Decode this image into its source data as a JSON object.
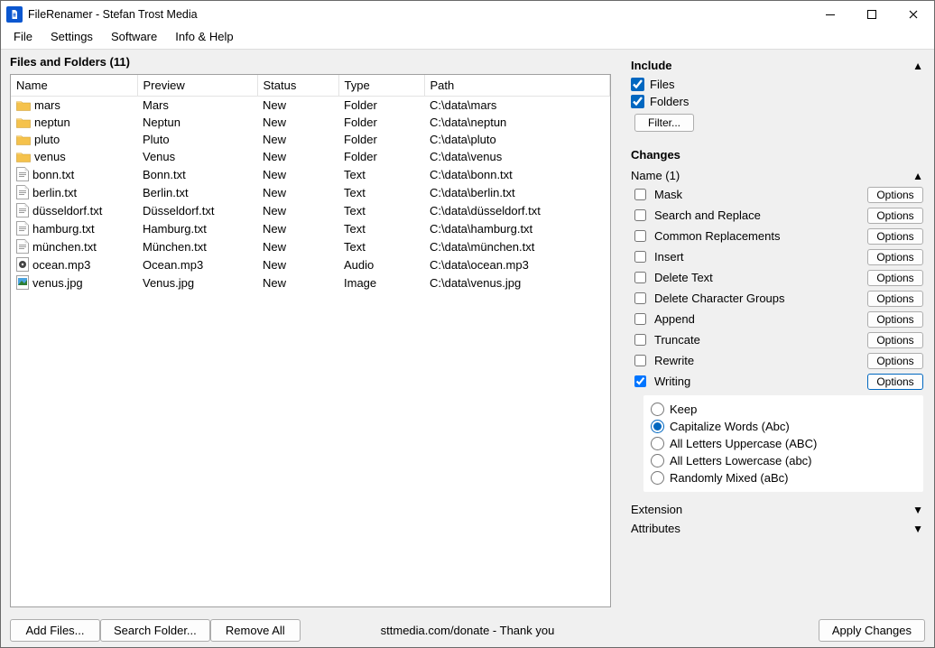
{
  "window": {
    "title": "FileRenamer - Stefan Trost Media"
  },
  "menu": [
    "File",
    "Settings",
    "Software",
    "Info & Help"
  ],
  "files_header_label": "Files and Folders",
  "files_count": 11,
  "columns": [
    "Name",
    "Preview",
    "Status",
    "Type",
    "Path"
  ],
  "rows": [
    {
      "icon": "folder",
      "name": "mars",
      "preview": "Mars",
      "status": "New",
      "type": "Folder",
      "path": "C:\\data\\mars"
    },
    {
      "icon": "folder",
      "name": "neptun",
      "preview": "Neptun",
      "status": "New",
      "type": "Folder",
      "path": "C:\\data\\neptun"
    },
    {
      "icon": "folder",
      "name": "pluto",
      "preview": "Pluto",
      "status": "New",
      "type": "Folder",
      "path": "C:\\data\\pluto"
    },
    {
      "icon": "folder",
      "name": "venus",
      "preview": "Venus",
      "status": "New",
      "type": "Folder",
      "path": "C:\\data\\venus"
    },
    {
      "icon": "text",
      "name": "bonn.txt",
      "preview": "Bonn.txt",
      "status": "New",
      "type": "Text",
      "path": "C:\\data\\bonn.txt"
    },
    {
      "icon": "text",
      "name": "berlin.txt",
      "preview": "Berlin.txt",
      "status": "New",
      "type": "Text",
      "path": "C:\\data\\berlin.txt"
    },
    {
      "icon": "text",
      "name": "düsseldorf.txt",
      "preview": "Düsseldorf.txt",
      "status": "New",
      "type": "Text",
      "path": "C:\\data\\düsseldorf.txt"
    },
    {
      "icon": "text",
      "name": "hamburg.txt",
      "preview": "Hamburg.txt",
      "status": "New",
      "type": "Text",
      "path": "C:\\data\\hamburg.txt"
    },
    {
      "icon": "text",
      "name": "münchen.txt",
      "preview": "München.txt",
      "status": "New",
      "type": "Text",
      "path": "C:\\data\\münchen.txt"
    },
    {
      "icon": "audio",
      "name": "ocean.mp3",
      "preview": "Ocean.mp3",
      "status": "New",
      "type": "Audio",
      "path": "C:\\data\\ocean.mp3"
    },
    {
      "icon": "image",
      "name": "venus.jpg",
      "preview": "Venus.jpg",
      "status": "New",
      "type": "Image",
      "path": "C:\\data\\venus.jpg"
    }
  ],
  "include": {
    "title": "Include",
    "files_label": "Files",
    "files_checked": true,
    "folders_label": "Folders",
    "folders_checked": true,
    "filter_label": "Filter..."
  },
  "changes": {
    "title": "Changes",
    "name_header": "Name (1)",
    "items": [
      {
        "label": "Mask",
        "checked": false,
        "options": "Options"
      },
      {
        "label": "Search and Replace",
        "checked": false,
        "options": "Options"
      },
      {
        "label": "Common Replacements",
        "checked": false,
        "options": "Options"
      },
      {
        "label": "Insert",
        "checked": false,
        "options": "Options"
      },
      {
        "label": "Delete Text",
        "checked": false,
        "options": "Options"
      },
      {
        "label": "Delete Character Groups",
        "checked": false,
        "options": "Options"
      },
      {
        "label": "Append",
        "checked": false,
        "options": "Options"
      },
      {
        "label": "Truncate",
        "checked": false,
        "options": "Options"
      },
      {
        "label": "Rewrite",
        "checked": false,
        "options": "Options"
      },
      {
        "label": "Writing",
        "checked": true,
        "options": "Options",
        "active_options": true
      }
    ],
    "writing_options": [
      {
        "label": "Keep",
        "selected": false
      },
      {
        "label": "Capitalize Words (Abc)",
        "selected": true
      },
      {
        "label": "All Letters Uppercase (ABC)",
        "selected": false
      },
      {
        "label": "All Letters Lowercase (abc)",
        "selected": false
      },
      {
        "label": "Randomly Mixed (aBc)",
        "selected": false
      }
    ],
    "extension_label": "Extension",
    "attributes_label": "Attributes"
  },
  "bottom": {
    "add_files": "Add Files...",
    "search_folder": "Search Folder...",
    "remove_all": "Remove All",
    "donate": "sttmedia.com/donate - Thank you",
    "apply": "Apply Changes"
  }
}
